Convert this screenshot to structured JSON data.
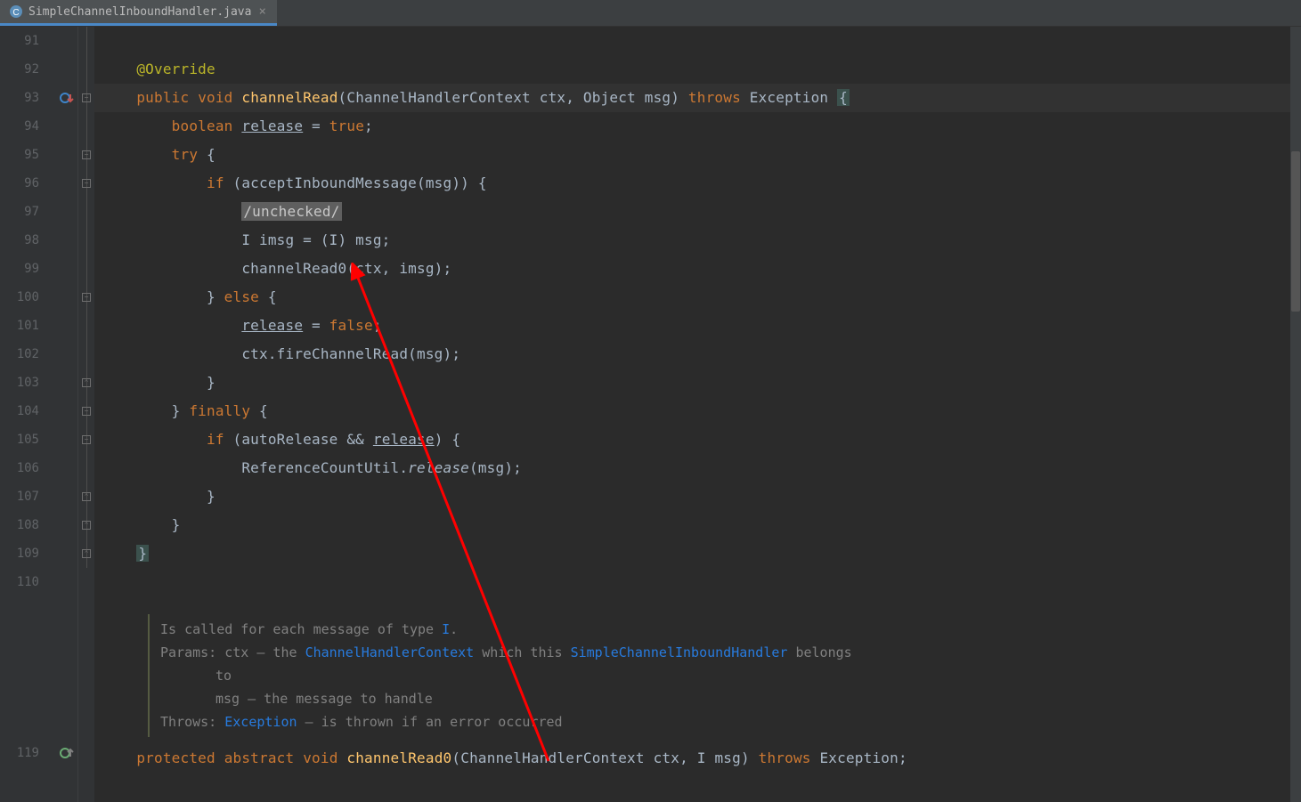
{
  "tab": {
    "filename": "SimpleChannelInboundHandler.java",
    "close_glyph": "×"
  },
  "gutter_icons": {
    "override_line": 93,
    "implement_line": 119
  },
  "code": {
    "l91": "",
    "l92_ann": "@Override",
    "l93_mod1": "public",
    "l93_mod2": "void",
    "l93_fn": "channelRead",
    "l93_p1t": "ChannelHandlerContext",
    "l93_p1n": "ctx",
    "l93_p2t": "Object",
    "l93_p2n": "msg",
    "l93_throws": "throws",
    "l93_exc": "Exception",
    "l93_brace": "{",
    "l94_t": "boolean",
    "l94_v": "release",
    "l94_eq": " = ",
    "l94_val": "true",
    "l94_sc": ";",
    "l95_try": "try",
    "l95_brace": " {",
    "l96_if": "if",
    "l96_open": " (",
    "l96_fn": "acceptInboundMessage",
    "l96_arg": "(msg)) {",
    "l97_cmt": "/unchecked/",
    "l98_t": "I",
    "l98_v": " imsg = (",
    "l98_cast": "I",
    "l98_rest": ") msg;",
    "l99_fn": "channelRead0",
    "l99_args": "(ctx, imsg);",
    "l100_close": "}",
    "l100_else": " else ",
    "l100_open": "{",
    "l101_v": "release",
    "l101_rest": " = ",
    "l101_val": "false",
    "l101_sc": ";",
    "l102": "ctx.fireChannelRead(msg);",
    "l103": "}",
    "l104_close": "}",
    "l104_finally": " finally ",
    "l104_open": "{",
    "l105_if": "if",
    "l105_open": " (",
    "l105_v1": "autoRelease",
    "l105_amp": " && ",
    "l105_v2": "release",
    "l105_close": ") {",
    "l106_cls": "ReferenceCountUtil",
    "l106_dot": ".",
    "l106_m": "release",
    "l106_args": "(msg);",
    "l107": "}",
    "l108": "}",
    "l109": "}",
    "l119_mod1": "protected",
    "l119_mod2": "abstract",
    "l119_mod3": "void",
    "l119_fn": "channelRead0",
    "l119_p1t": "ChannelHandlerContext",
    "l119_p1n": "ctx",
    "l119_p2t": "I",
    "l119_p2n": "msg",
    "l119_throws": "throws",
    "l119_exc": "Exception",
    "l119_sc": ";"
  },
  "doc": {
    "summary_pre": "Is called for each message of type ",
    "summary_type": "I",
    "summary_post": ".",
    "params_label": "Params:",
    "p1_name": "ctx",
    "p1_dash": " – the ",
    "p1_type": "ChannelHandlerContext",
    "p1_mid": " which this ",
    "p1_type2": "SimpleChannelInboundHandler",
    "p1_tail": " belongs",
    "p1_to": "to",
    "p2_name": "msg",
    "p2_text": " – the message to handle",
    "throws_label": "Throws:",
    "throws_type": "Exception",
    "throws_text": " – is thrown if an error occurred"
  },
  "line_numbers": [
    "91",
    "92",
    "93",
    "94",
    "95",
    "96",
    "97",
    "98",
    "99",
    "100",
    "101",
    "102",
    "103",
    "104",
    "105",
    "106",
    "107",
    "108",
    "109",
    "110",
    "119"
  ],
  "colors": {
    "bg": "#2b2b2b",
    "gutter": "#313335",
    "keyword": "#cc7832",
    "annotation": "#bbb529",
    "function": "#ffc66d",
    "doc_link": "#287bde",
    "arrow": "#ff0000",
    "tab_active_underline": "#4a88c7"
  }
}
